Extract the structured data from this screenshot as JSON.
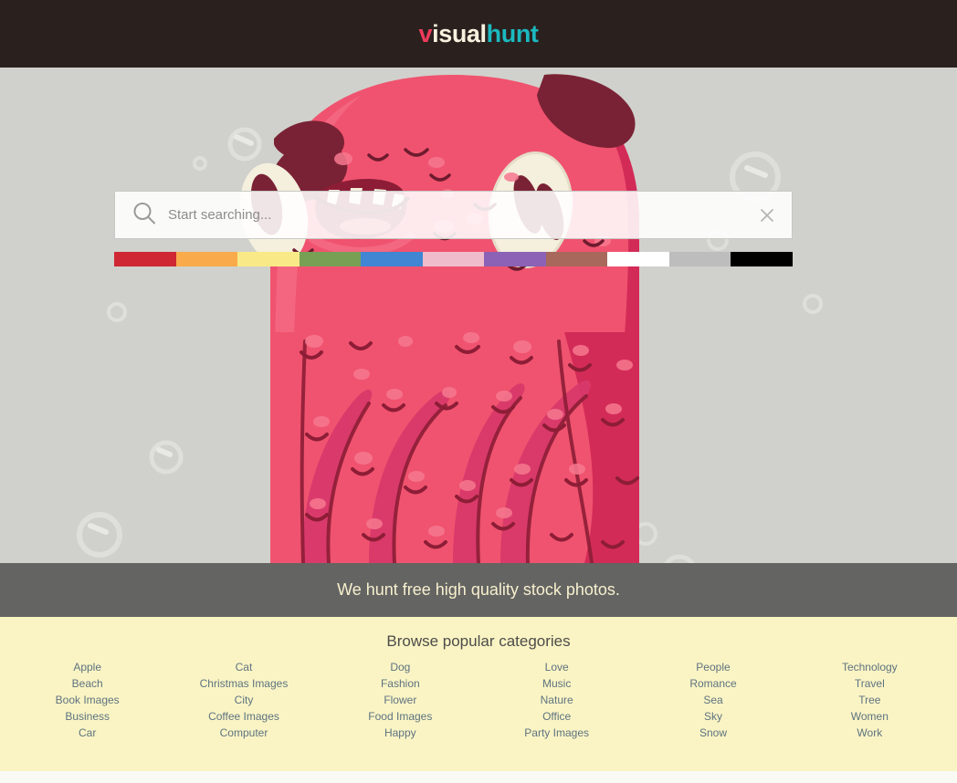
{
  "header": {
    "logo": {
      "part1": "v",
      "part2": "isual",
      "part3": "hunt"
    },
    "colors": {
      "bar": "#2a211f",
      "v": "#ef3b5b",
      "isual": "#f7f2df",
      "hunt": "#1bb9bf"
    }
  },
  "search": {
    "placeholder": "Start searching...",
    "value": "",
    "icon": "search-icon",
    "clear_icon": "close-icon"
  },
  "color_filters": [
    {
      "name": "red",
      "hex": "#cf2734"
    },
    {
      "name": "orange",
      "hex": "#f9ab4c"
    },
    {
      "name": "yellow",
      "hex": "#f9ea87"
    },
    {
      "name": "green",
      "hex": "#78a055"
    },
    {
      "name": "blue",
      "hex": "#4186d3"
    },
    {
      "name": "pink",
      "hex": "#efbccb"
    },
    {
      "name": "purple",
      "hex": "#8b62b5"
    },
    {
      "name": "brown",
      "hex": "#a8695c"
    },
    {
      "name": "white",
      "hex": "#ffffff"
    },
    {
      "name": "gray",
      "hex": "#bdbdbd"
    },
    {
      "name": "black",
      "hex": "#000000"
    }
  ],
  "tagline": {
    "text": "We hunt free high quality stock photos."
  },
  "categories": {
    "title": "Browse popular categories",
    "columns": [
      {
        "items": [
          "Apple",
          "Beach",
          "Book Images",
          "Business",
          "Car"
        ]
      },
      {
        "items": [
          "Cat",
          "Christmas Images",
          "City",
          "Coffee Images",
          "Computer"
        ]
      },
      {
        "items": [
          "Dog",
          "Fashion",
          "Flower",
          "Food Images",
          "Happy"
        ]
      },
      {
        "items": [
          "Love",
          "Music",
          "Nature",
          "Office",
          "Party Images"
        ]
      },
      {
        "items": [
          "People",
          "Romance",
          "Sea",
          "Sky",
          "Snow"
        ]
      },
      {
        "items": [
          "Technology",
          "Travel",
          "Tree",
          "Women",
          "Work"
        ]
      }
    ]
  },
  "hero": {
    "background_color": "#d0d1cc",
    "illustration": "pink-monster-octopus",
    "monster_colors": {
      "body": "#f0536f",
      "body_dark": "#d32b57",
      "shade": "#c32450",
      "highlight": "#f7798f",
      "spot_dark": "#7a2235",
      "mouth": "#8d1d36",
      "tongue": "#e0596f",
      "teeth": "#f5efdd",
      "eye_white": "#f5efdd",
      "pupil": "#7a2235",
      "outline": "#6e1b2f"
    },
    "bubble_color": "#dddedb"
  },
  "footer_strip": {
    "color": "#fafaf5"
  }
}
